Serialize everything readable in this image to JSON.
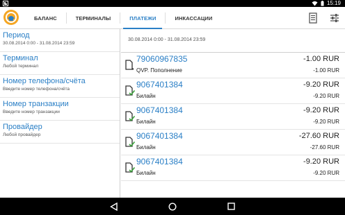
{
  "status_bar": {
    "time": "15:19"
  },
  "tabs": [
    {
      "label": "БАЛАНС"
    },
    {
      "label": "ТЕРМИНАЛЫ"
    },
    {
      "label": "ПЛАТЕЖИ"
    },
    {
      "label": "ИНКАССАЦИИ"
    }
  ],
  "active_tab": "ПЛАТЕЖИ",
  "filters": [
    {
      "title": "Период",
      "value": "30.08.2014 0:00 - 31.08.2014 23:59"
    },
    {
      "title": "Терминал",
      "value": "Любой терминал"
    },
    {
      "title": "Номер телефона/счёта",
      "value": "Введите номер телефона/счёта"
    },
    {
      "title": "Номер транзакции",
      "value": "Введите номер транзакции"
    },
    {
      "title": "Провайдер",
      "value": "Любой провайдер"
    }
  ],
  "main": {
    "date_range": "30.08.2014 0:00 - 31.08.2014 23:59",
    "transactions": [
      {
        "account": "79060967835",
        "provider": "QVP. Пополнение",
        "amount": "-1.00 RUR",
        "amount2": "-1.00 RUR",
        "icon": "document-pending-icon"
      },
      {
        "account": "9067401384",
        "provider": "Билайн",
        "amount": "-9.20 RUR",
        "amount2": "-9.20 RUR",
        "icon": "document-check-icon"
      },
      {
        "account": "9067401384",
        "provider": "Билайн",
        "amount": "-9.20 RUR",
        "amount2": "-9.20 RUR",
        "icon": "document-check-icon"
      },
      {
        "account": "9067401384",
        "provider": "Билайн",
        "amount": "-27.60 RUR",
        "amount2": "-27.60 RUR",
        "icon": "document-check-icon"
      },
      {
        "account": "9067401384",
        "provider": "Билайн",
        "amount": "-9.20 RUR",
        "amount2": "-9.20 RUR",
        "icon": "document-check-icon"
      }
    ]
  },
  "colors": {
    "accent": "#2a7fc6",
    "check": "#3aa33a",
    "logo": "#f5a623"
  }
}
